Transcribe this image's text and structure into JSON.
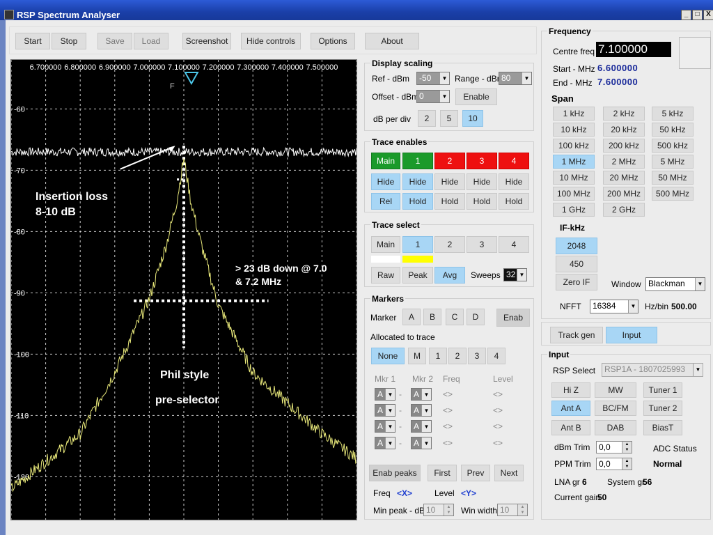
{
  "window": {
    "title": "RSP Spectrum Analyser",
    "buttons": [
      "_",
      "□",
      "X"
    ]
  },
  "toolbar": {
    "start": "Start",
    "stop": "Stop",
    "save": "Save",
    "load": "Load",
    "screenshot": "Screenshot",
    "hide_controls": "Hide controls",
    "options": "Options",
    "about": "About"
  },
  "plot": {
    "freq_labels": [
      "6.700000",
      "6.800000",
      "6.900000",
      "7.000000",
      "7.100000",
      "7.200000",
      "7.300000",
      "7.400000",
      "7.500000"
    ],
    "db_labels": [
      "-60",
      "-70",
      "-80",
      "-90",
      "-100",
      "-110",
      "-120"
    ],
    "marker_letter": "F",
    "annotations": {
      "loss1": "Insertion loss",
      "loss2": "8-10 dB",
      "down1": "> 23 dB down @ 7.0",
      "down2": "& 7.2 MHz",
      "phil1": "Phil style",
      "phil2": "pre-selector"
    },
    "colors": {
      "main_trace": "#ffffff",
      "trace1": "#e8e87a",
      "grid": "#ffffff"
    }
  },
  "chart_data": {
    "type": "line",
    "x_unit": "MHz",
    "y_unit": "dBm",
    "xlim": [
      6.6,
      7.6
    ],
    "ylim": [
      -127,
      -52
    ],
    "series": [
      {
        "name": "Main",
        "x": [
          6.6,
          7.1,
          7.6
        ],
        "y": [
          -67,
          -67,
          -67
        ]
      },
      {
        "name": "1",
        "x": [
          6.6,
          6.8,
          6.9,
          7.0,
          7.05,
          7.08,
          7.1,
          7.12,
          7.15,
          7.2,
          7.3,
          7.5,
          7.6
        ],
        "y": [
          -122,
          -113,
          -103,
          -91,
          -82,
          -75,
          -68,
          -75,
          -82,
          -92,
          -103,
          -113,
          -117
        ]
      }
    ]
  },
  "display_scaling": {
    "title": "Display scaling",
    "ref_label": "Ref - dBm",
    "ref_value": "-50",
    "range_label": "Range - dBm",
    "range_value": "80",
    "offset_label": "Offset - dBm",
    "offset_value": "0",
    "enable": "Enable",
    "dbdiv_label": "dB per div",
    "dbdiv": [
      "2",
      "5",
      "10"
    ]
  },
  "trace_enables": {
    "title": "Trace enables",
    "names": [
      "Main",
      "1",
      "2",
      "3",
      "4"
    ],
    "hide": [
      "Hide",
      "Hide",
      "Hide",
      "Hide",
      "Hide"
    ],
    "row3": [
      "Rel",
      "Hold",
      "Hold",
      "Hold",
      "Hold"
    ],
    "colors": [
      "#1b9a2a",
      "#1b9a2a",
      "#ee1010",
      "#ee1010",
      "#ee1010"
    ]
  },
  "trace_select": {
    "title": "Trace select",
    "names": [
      "Main",
      "1",
      "2",
      "3",
      "4"
    ],
    "swatches": [
      "#ffffff",
      "#ffff00"
    ],
    "raw": "Raw",
    "peak": "Peak",
    "avg": "Avg",
    "sweeps_label": "Sweeps",
    "sweeps_value": "32"
  },
  "markers": {
    "title": "Markers",
    "marker_label": "Marker",
    "letters": [
      "A",
      "B",
      "C",
      "D"
    ],
    "enab": "Enab",
    "allocated_label": "Allocated to trace",
    "alloc": [
      "None",
      "M",
      "1",
      "2",
      "3",
      "4"
    ],
    "mkr1": "Mkr 1",
    "mkr2": "Mkr 2",
    "freq": "Freq",
    "level": "Level",
    "row_val": "A",
    "dash": "-",
    "brackets": "<>",
    "enab_peaks": "Enab peaks",
    "first": "First",
    "prev": "Prev",
    "next": "Next",
    "freq_label": "Freq",
    "freq_value": "<X>",
    "level_label": "Level",
    "level_value": "<Y>",
    "minpeak_label": "Min peak - dB",
    "minpeak_value": "10",
    "winwidth_label": "Win width",
    "winwidth_value": "10"
  },
  "frequency": {
    "title": "Frequency",
    "centre_label": "Centre freq",
    "centre_value": "7.100000",
    "start_label": "Start - MHz",
    "start_value": "6.600000",
    "end_label": "End - MHz",
    "end_value": "7.600000",
    "span_title": "Span",
    "spans": [
      "1 kHz",
      "2 kHz",
      "5 kHz",
      "10 kHz",
      "20 kHz",
      "50 kHz",
      "100 kHz",
      "200 kHz",
      "500 kHz",
      "1 MHz",
      "2 MHz",
      "5 MHz",
      "10 MHz",
      "20 MHz",
      "50 MHz",
      "100 MHz",
      "200 MHz",
      "500 MHz",
      "1 GHz",
      "2 GHz"
    ],
    "if_title": "IF-kHz",
    "if_opts": [
      "2048",
      "450",
      "Zero IF"
    ],
    "window_label": "Window",
    "window_value": "Blackman",
    "nfft_label": "NFFT",
    "nfft_value": "16384",
    "hzbin_label": "Hz/bin",
    "hzbin_value": "500.00"
  },
  "tabs": {
    "track_gen": "Track gen",
    "input": "Input"
  },
  "input": {
    "title": "Input",
    "rsp_label": "RSP Select",
    "rsp_value": "RSP1A - 1807025993",
    "buttons": [
      "Hi Z",
      "MW",
      "Tuner 1",
      "Ant A",
      "BC/FM",
      "Tuner 2",
      "Ant B",
      "DAB",
      "BiasT"
    ],
    "dbm_trim_label": "dBm Trim",
    "dbm_trim_value": "0,0",
    "ppm_trim_label": "PPM Trim",
    "ppm_trim_value": "0,0",
    "adc_label": "ADC Status",
    "adc_value": "Normal",
    "lna_label": "LNA gr",
    "lna_value": "6",
    "sysgr_label": "System gr",
    "sysgr_value": "56",
    "gain_label": "Current gain",
    "gain_value": "50"
  }
}
